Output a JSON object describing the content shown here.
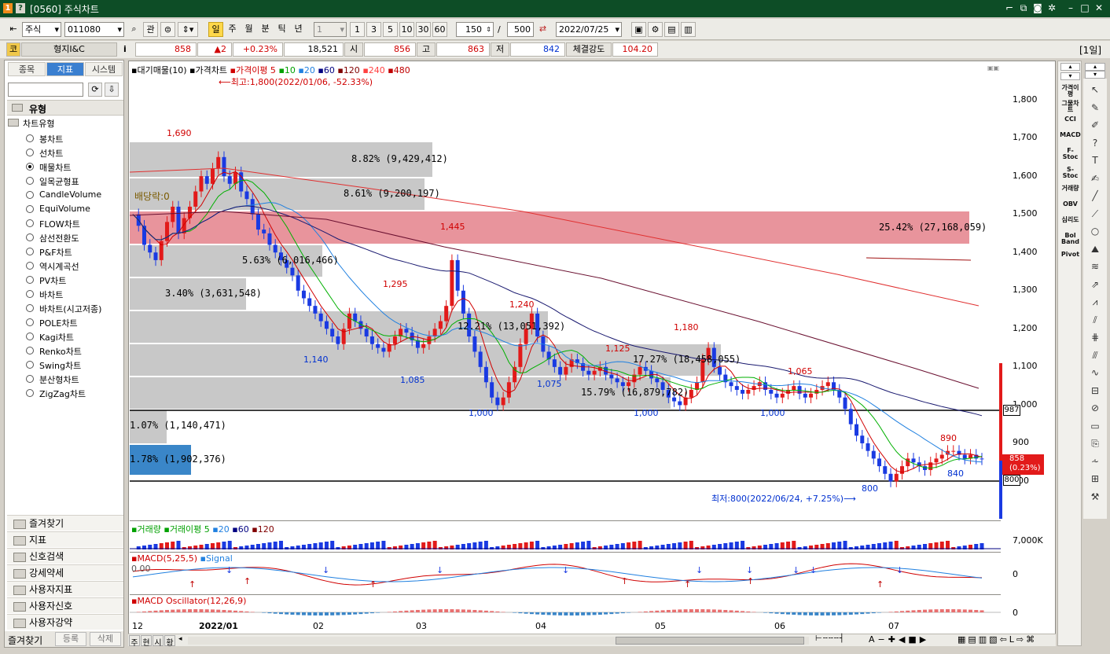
{
  "window": {
    "badge1": "1",
    "badge2": "?",
    "title": "[0560] 주식차트"
  },
  "toolbar": {
    "market": "주식",
    "code": "011080",
    "search_btn": "관",
    "periods": [
      "일",
      "주",
      "월",
      "분",
      "틱",
      "년"
    ],
    "interval": "1",
    "interval_buttons": [
      "1",
      "3",
      "5",
      "10",
      "30",
      "60"
    ],
    "count": "150",
    "separator": "/",
    "max_count": "500",
    "date": "2022/07/25"
  },
  "quote": {
    "market_tag": "코",
    "name": "형지I&C",
    "info_icon": "i",
    "price": "858",
    "change": "▲2",
    "change_pct": "+0.23%",
    "volume": "18,521",
    "open_label": "시",
    "open": "856",
    "high_label": "고",
    "high": "863",
    "low_label": "저",
    "low": "842",
    "strength_label": "체결강도",
    "strength": "104.20",
    "period_tag": "[1일]"
  },
  "left_panel": {
    "tabs": [
      "종목",
      "지표",
      "시스템"
    ],
    "section_title": "유형",
    "group_title": "차트유형",
    "chart_types": [
      "봉차트",
      "선차트",
      "매물차트",
      "일목균형표",
      "CandleVolume",
      "EquiVolume",
      "FLOW차트",
      "삼선전환도",
      "P&F차트",
      "역시계곡선",
      "PV차트",
      "바차트",
      "바차트(시고저종)",
      "POLE차트",
      "Kagi차트",
      "Renko차트",
      "Swing차트",
      "분산형차트",
      "ZigZag차트"
    ],
    "selected_index": 2,
    "folders": [
      "즐겨찾기",
      "지표",
      "신호검색",
      "강세약세",
      "사용자지표",
      "사용자신호",
      "사용자강약"
    ],
    "bottom_tabs": [
      "즐겨찾기",
      "등록",
      "삭제"
    ]
  },
  "price_panel": {
    "legend": [
      "대기매물(10)",
      "가격차트",
      "가격이평 5",
      "10",
      "20",
      "60",
      "120",
      "240",
      "480"
    ],
    "legend_colors": [
      "#000000",
      "#000000",
      "#d00000",
      "#00a000",
      "#2080e0",
      "#000080",
      "#800000",
      "#ff4040",
      "#c00000"
    ],
    "max_note": "⟵최고:1,800(2022/01/06, -52.33%)",
    "min_note": "최저:800(2022/06/24, +7.25%)⟶",
    "bands": [
      {
        "label": "8.82% (9,429,412)",
        "color": "#c8c8c8"
      },
      {
        "label": "8.61% (9,200,197)",
        "color": "#c8c8c8"
      },
      {
        "label": "25.42% (27,168,059)",
        "color": "#e8949c"
      },
      {
        "label": "5.63% (6,016,466)",
        "color": "#c8c8c8"
      },
      {
        "label": "3.40% (3,631,548)",
        "color": "#c8c8c8"
      },
      {
        "label": "12.21% (13,051,392)",
        "color": "#c8c8c8"
      },
      {
        "label": "17.27% (18,458,055)",
        "color": "#c8c8c8"
      },
      {
        "label": "15.79% (16,879,782)",
        "color": "#c8c8c8"
      },
      {
        "label": "1.07% (1,140,471)",
        "color": "#c8c8c8"
      },
      {
        "label": "1.78% (1,902,376)",
        "color": "#3a86c8"
      }
    ],
    "dividend_label": "배당락:0",
    "y_ticks": [
      "1,800",
      "1,700",
      "1,600",
      "1,500",
      "1,400",
      "1,300",
      "1,200",
      "1,100",
      "1,000",
      "900",
      "800"
    ],
    "hline_upper": "987",
    "hline_lower": "800",
    "current_price": "858",
    "current_pct": "(0.23%)",
    "peaks": [
      {
        "text": "1,690",
        "color": "#d00000"
      },
      {
        "text": "1,445",
        "color": "#d00000"
      },
      {
        "text": "1,295",
        "color": "#d00000"
      },
      {
        "text": "1,240",
        "color": "#d00000"
      },
      {
        "text": "1,180",
        "color": "#d00000"
      },
      {
        "text": "1,125",
        "color": "#d00000"
      },
      {
        "text": "1,065",
        "color": "#d00000"
      },
      {
        "text": "890",
        "color": "#d00000"
      }
    ],
    "troughs": [
      {
        "text": "1,140",
        "color": "#0030d0"
      },
      {
        "text": "1,085",
        "color": "#0030d0"
      },
      {
        "text": "1,075",
        "color": "#0030d0"
      },
      {
        "text": "840",
        "color": "#0030d0"
      },
      {
        "text": "1,000",
        "color": "#0030d0"
      },
      {
        "text": "1,000",
        "color": "#0030d0"
      },
      {
        "text": "1,000",
        "color": "#0030d0"
      },
      {
        "text": "800",
        "color": "#0030d0"
      }
    ]
  },
  "volume_panel": {
    "legend": [
      "거래량",
      "거래이평 5",
      "20",
      "60",
      "120"
    ],
    "legend_colors": [
      "#00a000",
      "#00a000",
      "#2080e0",
      "#000080",
      "#800000"
    ],
    "y_tick": "7,000K"
  },
  "macd_panel": {
    "legend": [
      "MACD(5,25,5)",
      "Signal"
    ],
    "legend_colors": [
      "#d00000",
      "#2080e0"
    ],
    "corner_value": "0.00",
    "y_tick": "0"
  },
  "osc_panel": {
    "legend": "MACD Oscillator(12,26,9)",
    "y_tick": "0"
  },
  "x_axis": [
    "12",
    "2022/01",
    "02",
    "03",
    "04",
    "05",
    "06",
    "07"
  ],
  "bottom_tabs": [
    "주",
    "현",
    "시",
    "황"
  ],
  "right_toolbar": [
    "가격이평",
    "그물차트",
    "CCI",
    "MACD",
    "F-Stoc",
    "S-Stoc",
    "거래량",
    "OBV",
    "심리도",
    "Bol Band",
    "Pivot"
  ]
}
